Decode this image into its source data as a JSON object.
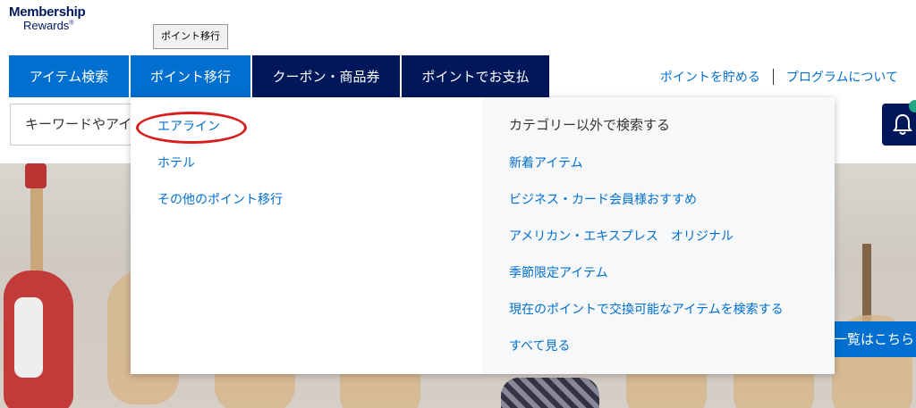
{
  "logo": {
    "line1": "Membership",
    "line2": "Rewards",
    "reg": "®"
  },
  "tooltip": "ポイント移行",
  "tabs": [
    {
      "label": "アイテム検索"
    },
    {
      "label": "ポイント移行"
    },
    {
      "label": "クーポン・商品券"
    },
    {
      "label": "ポイントでお支払"
    }
  ],
  "top_links": [
    {
      "label": "ポイントを貯める"
    },
    {
      "label": "プログラムについて"
    }
  ],
  "search": {
    "placeholder": "キーワードやアイ"
  },
  "dropdown": {
    "left_items": [
      {
        "label": "エアライン"
      },
      {
        "label": "ホテル"
      },
      {
        "label": "その他のポイント移行"
      }
    ],
    "right_heading": "カテゴリー以外で検索する",
    "right_items": [
      {
        "label": "新着アイテム"
      },
      {
        "label": "ビジネス・カード会員様おすすめ"
      },
      {
        "label": "アメリカン・エキスプレス　オリジナル"
      },
      {
        "label": "季節限定アイテム"
      },
      {
        "label": "現在のポイントで交換可能なアイテムを検索する"
      },
      {
        "label": "すべて見る"
      }
    ]
  },
  "promo": "一覧はこちら",
  "icons": {
    "bell": "bell-icon"
  },
  "colors": {
    "brand_blue": "#006fcf",
    "brand_navy": "#00175a",
    "annotation_red": "#d81e1e"
  }
}
